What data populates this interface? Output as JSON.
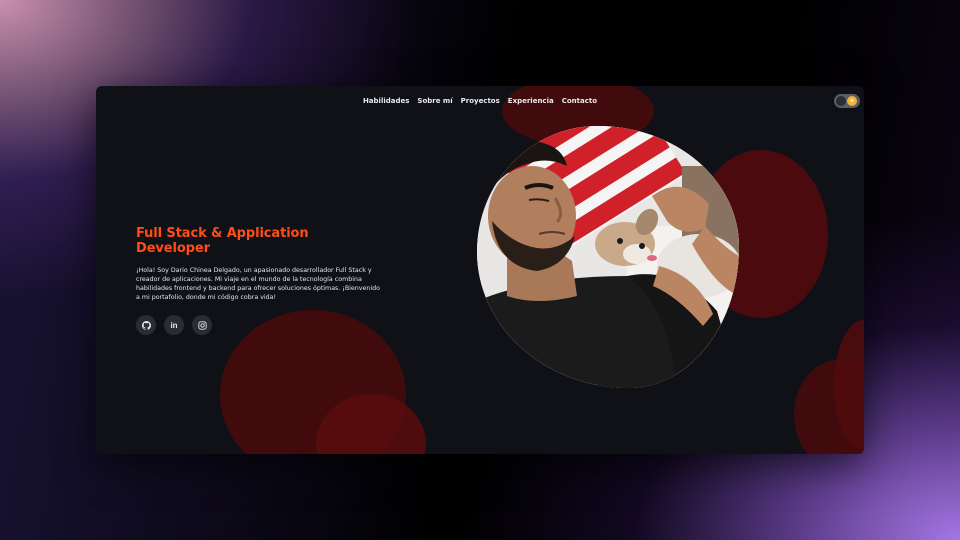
{
  "nav": {
    "items": [
      "Habilidades",
      "Sobre mí",
      "Proyectos",
      "Experiencia",
      "Contacto"
    ]
  },
  "theme_toggle": {
    "mode": "light",
    "icon": "sun-icon"
  },
  "hero": {
    "title": "Full Stack & Application Developer",
    "description": "¡Hola! Soy Dario Chinea Delgado, un apasionado desarrollador Full Stack y creador de aplicaciones. Mi viaje en el mundo de la tecnología combina habilidades frontend y backend para ofrecer soluciones óptimas. ¡Bienvenido a mi portafolio, donde mi código cobra vida!",
    "socials": [
      {
        "name": "github",
        "icon": "github-icon"
      },
      {
        "name": "linkedin",
        "icon": "linkedin-icon",
        "glyph": "in"
      },
      {
        "name": "instagram",
        "icon": "instagram-icon"
      }
    ]
  },
  "colors": {
    "accent": "#ff4d1a",
    "window_bg": "#0f1117",
    "blob": "#4a0a0c",
    "nav_text": "#e9e9ee"
  }
}
